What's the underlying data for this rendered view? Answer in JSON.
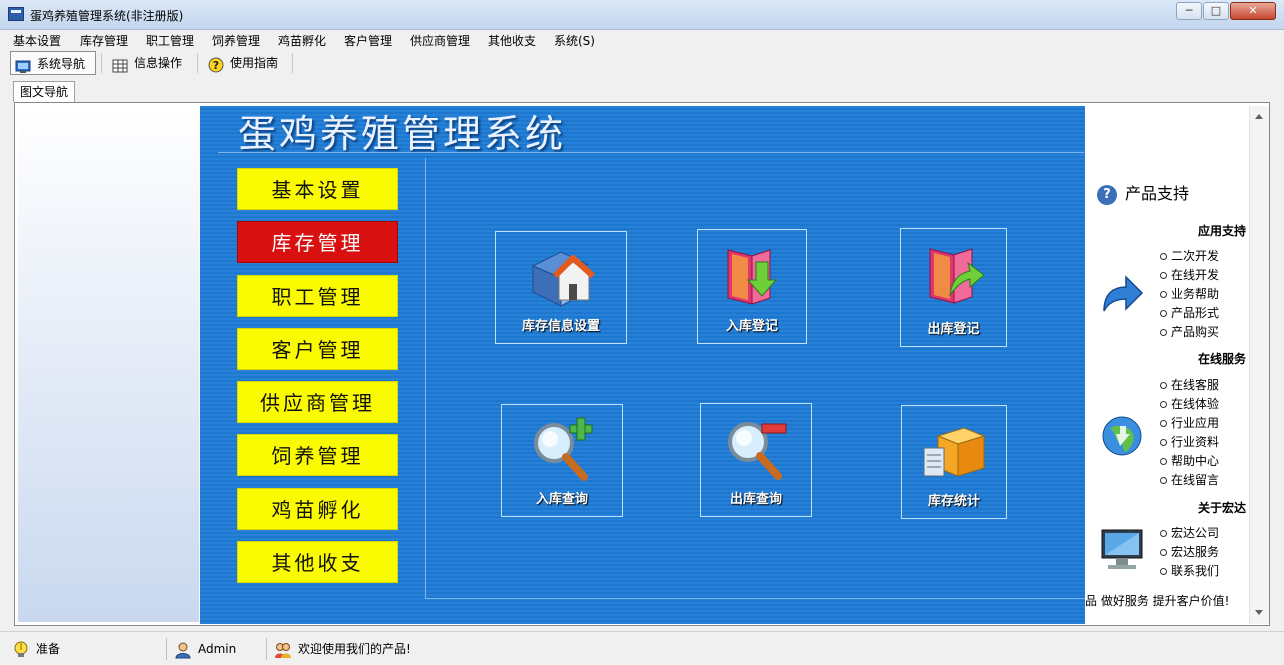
{
  "window": {
    "title": "蛋鸡养殖管理系统(非注册版)",
    "min_glyph": "─",
    "max_glyph": "□",
    "close_glyph": "✕"
  },
  "menu": [
    "基本设置",
    "库存管理",
    "职工管理",
    "饲养管理",
    "鸡苗孵化",
    "客户管理",
    "供应商管理",
    "其他收支",
    "系统(S)"
  ],
  "toolbar": {
    "nav_label": "系统导航",
    "info_label": "信息操作",
    "help_label": "使用指南"
  },
  "tab": {
    "label": "图文导航"
  },
  "panel": {
    "title": "蛋鸡养殖管理系统",
    "nav_buttons": [
      {
        "label": "基本设置",
        "active": false
      },
      {
        "label": "库存管理",
        "active": true
      },
      {
        "label": "职工管理",
        "active": false
      },
      {
        "label": "客户管理",
        "active": false
      },
      {
        "label": "供应商管理",
        "active": false
      },
      {
        "label": "饲养管理",
        "active": false
      },
      {
        "label": "鸡苗孵化",
        "active": false
      },
      {
        "label": "其他收支",
        "active": false
      }
    ],
    "tiles": [
      {
        "label": "库存信息设置",
        "icon": "folder-house-icon"
      },
      {
        "label": "入库登记",
        "icon": "folder-arrow-down-icon"
      },
      {
        "label": "出库登记",
        "icon": "folder-arrow-out-icon"
      },
      {
        "label": "入库查询",
        "icon": "magnifier-plus-icon"
      },
      {
        "label": "出库查询",
        "icon": "magnifier-minus-icon"
      },
      {
        "label": "库存统计",
        "icon": "boxes-icon"
      }
    ]
  },
  "support": {
    "heading": "产品支持",
    "sections": [
      {
        "title": "应用支持",
        "icon": "forward-arrow-icon",
        "links": [
          "二次开发",
          "在线开发",
          "业务帮助",
          "产品形式",
          "产品购买"
        ]
      },
      {
        "title": "在线服务",
        "icon": "globe-icon",
        "links": [
          "在线客服",
          "在线体验",
          "行业应用",
          "行业资料",
          "帮助中心",
          "在线留言"
        ]
      },
      {
        "title": "关于宏达",
        "icon": "monitor-icon",
        "links": [
          "宏达公司",
          "宏达服务",
          "联系我们"
        ]
      }
    ],
    "footer": "品  做好服务  提升客户价值!"
  },
  "status": {
    "ready": "准备",
    "user": "Admin",
    "message": "欢迎使用我们的产品!"
  },
  "colors": {
    "panel_blue": "#1e7cd6",
    "nav_yellow": "#fafa00",
    "nav_active_red": "#d91010"
  }
}
